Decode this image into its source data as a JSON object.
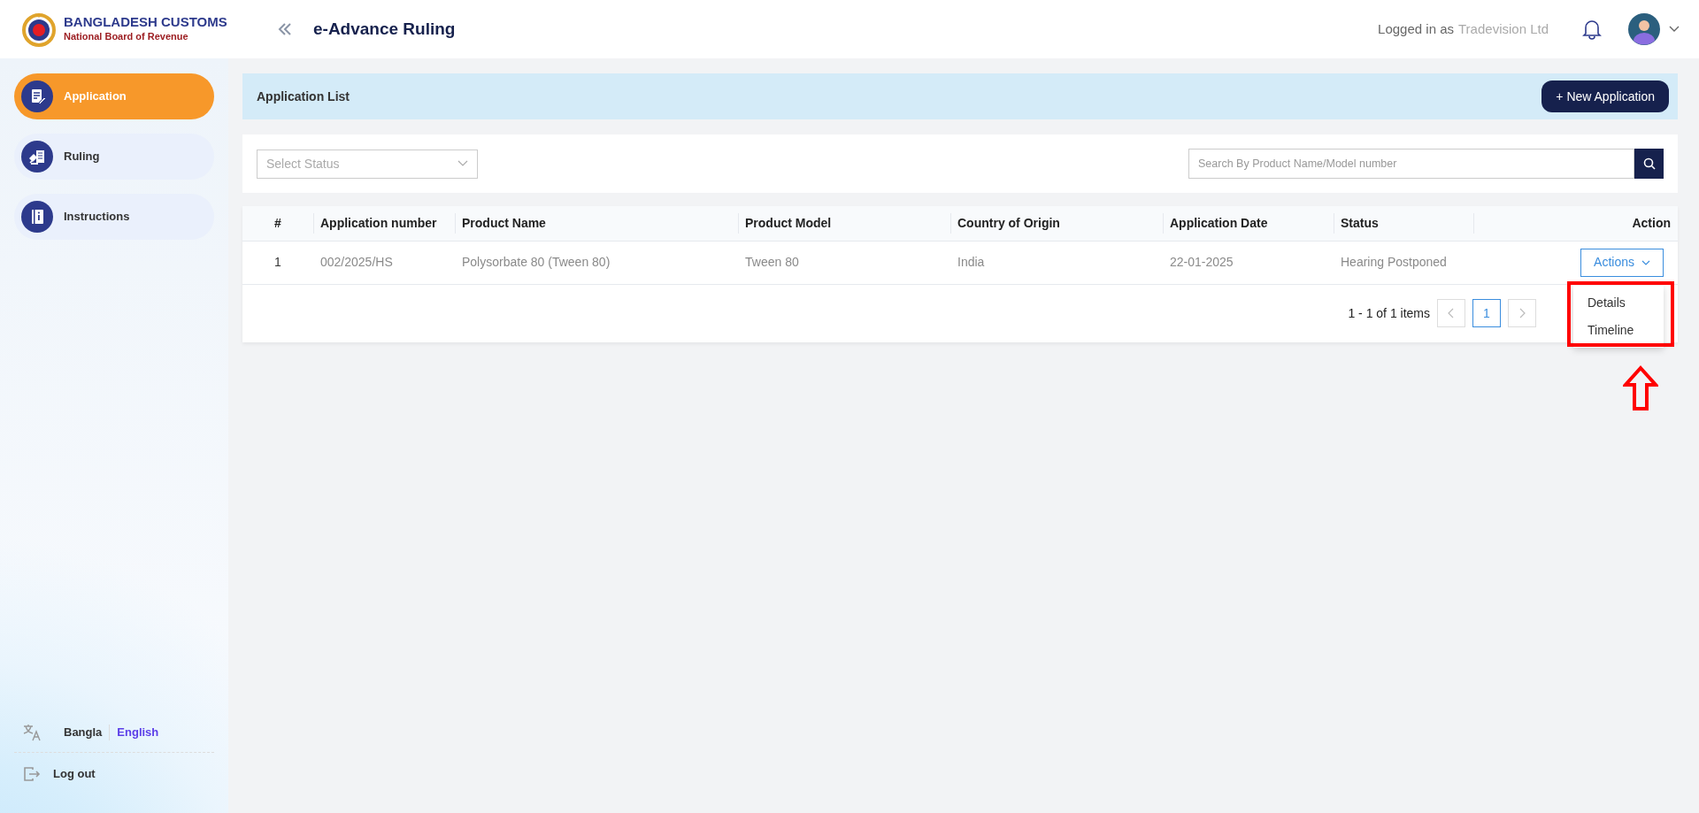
{
  "header": {
    "logo_title": "BANGLADESH CUSTOMS",
    "logo_subtitle": "National Board of Revenue",
    "page_title": "e-Advance Ruling",
    "logged_in_label": "Logged in as",
    "user_name": "Tradevision Ltd"
  },
  "sidebar": {
    "items": [
      {
        "label": "Application",
        "selected": true
      },
      {
        "label": "Ruling",
        "selected": false
      },
      {
        "label": "Instructions",
        "selected": false
      }
    ],
    "languages": [
      {
        "label": "Bangla",
        "selected": false
      },
      {
        "label": "English",
        "selected": true
      }
    ],
    "logout": "Log out"
  },
  "toolbar": {
    "title": "Application List",
    "new_button": "+ New Application"
  },
  "filters": {
    "status_placeholder": "Select Status",
    "search_placeholder": "Search By Product Name/Model number"
  },
  "table": {
    "columns": [
      "#",
      "Application number",
      "Product Name",
      "Product Model",
      "Country of Origin",
      "Application Date",
      "Status",
      "Action"
    ],
    "rows": [
      {
        "cells": [
          "1",
          "002/2025/HS",
          "Polysorbate 80 (Tween 80)",
          "Tween 80",
          "India",
          "22-01-2025",
          "Hearing Postponed"
        ],
        "action": "Actions",
        "menu_open": true
      }
    ],
    "action_menu": [
      "Details",
      "Timeline"
    ],
    "pagination": {
      "summary": "1 - 1 of 1 items",
      "pages": [
        {
          "label": "1",
          "selected": true
        }
      ]
    }
  },
  "annotations": {
    "highlight_box": true,
    "arrow": true
  }
}
